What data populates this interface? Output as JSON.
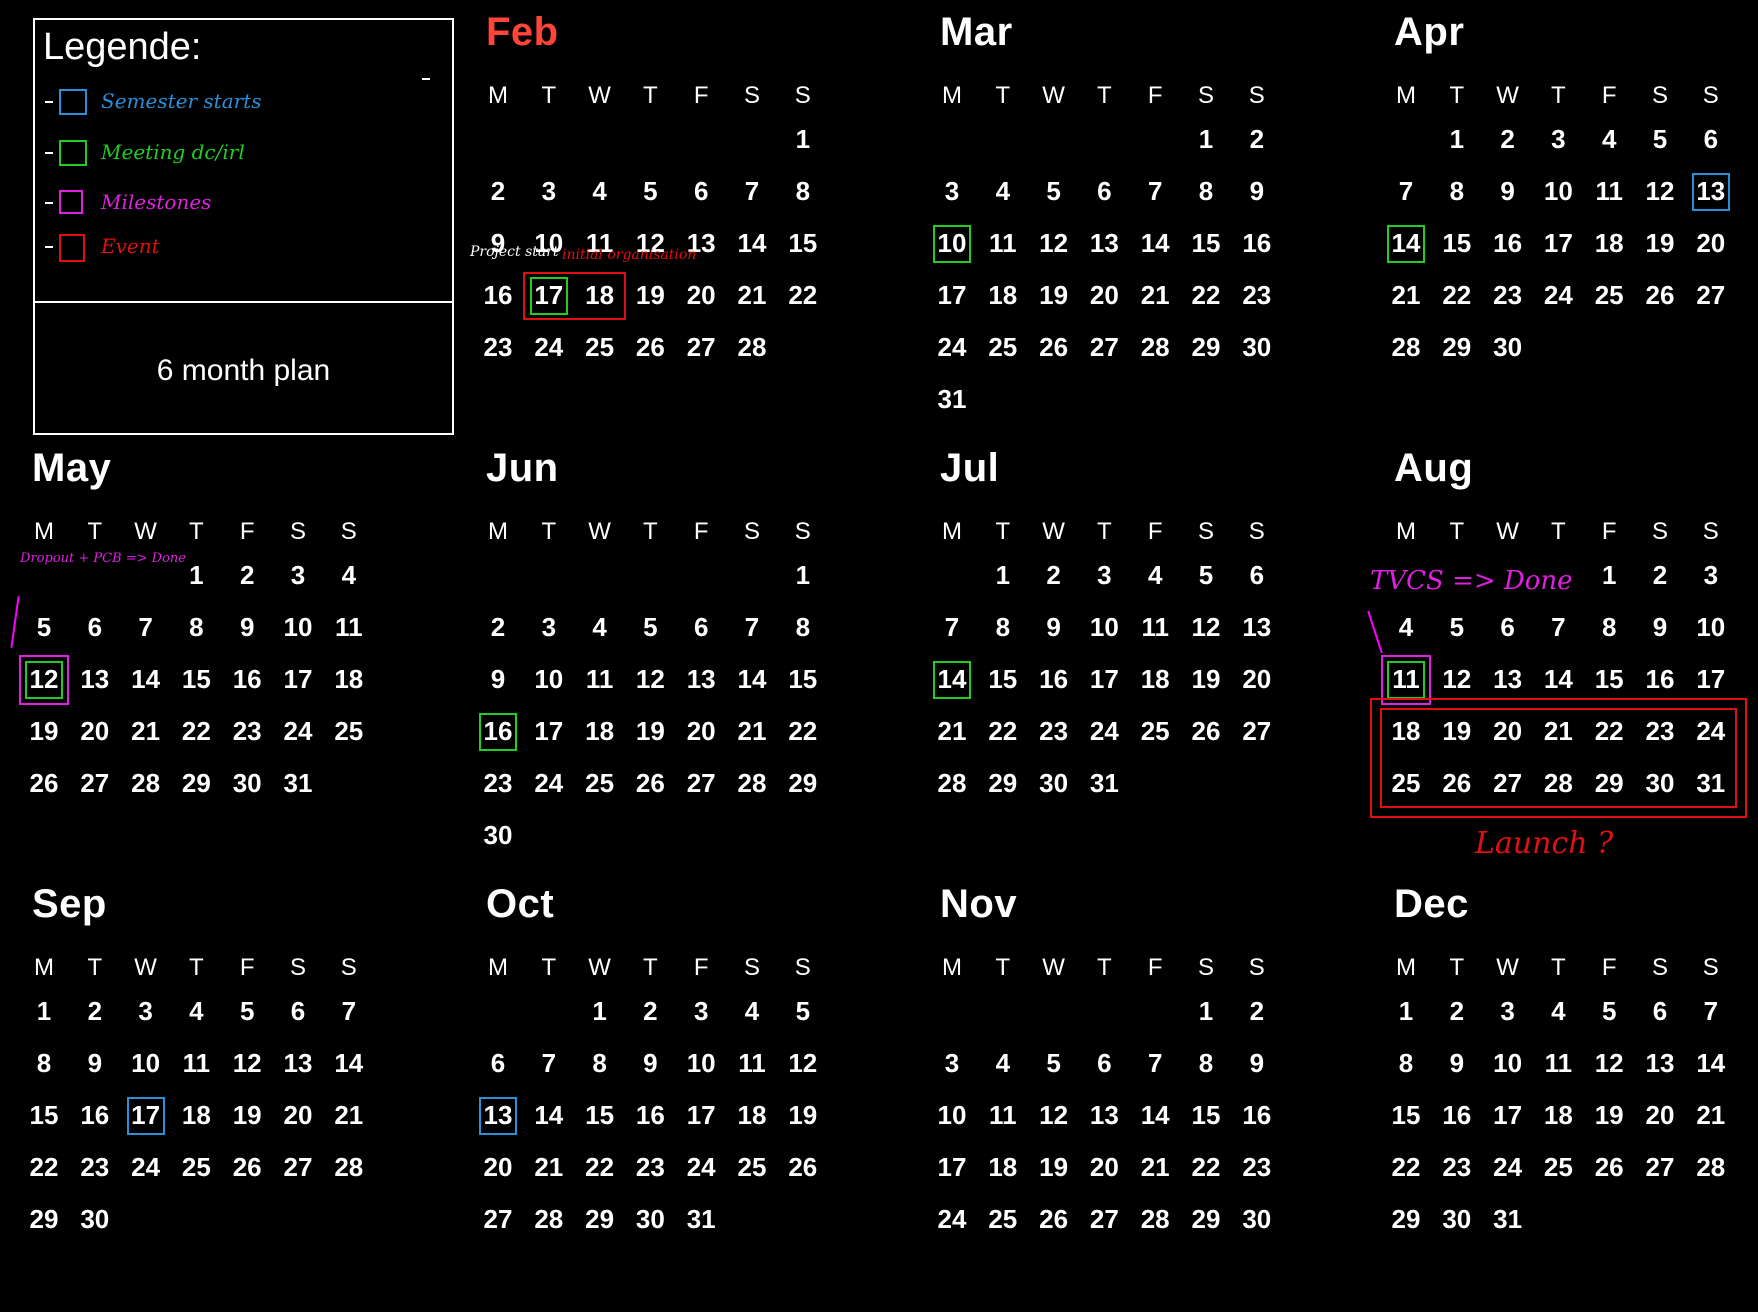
{
  "legend": {
    "title": "Legende:",
    "items": [
      {
        "label": "Semester starts",
        "color": "#2a8fd8"
      },
      {
        "label": "Meeting dc/irl",
        "color": "#22cc22"
      },
      {
        "label": "Milestones",
        "color": "#e020e0"
      },
      {
        "label": "Event",
        "color": "#e01010"
      }
    ],
    "plan": "6 month plan"
  },
  "weekday_headers": [
    "M",
    "T",
    "W",
    "T",
    "F",
    "S",
    "S"
  ],
  "months": [
    {
      "name": "Feb",
      "start": 6,
      "days": 28,
      "color": "#ff453a"
    },
    {
      "name": "Mar",
      "start": 5,
      "days": 31
    },
    {
      "name": "Apr",
      "start": 1,
      "days": 30
    },
    {
      "name": "May",
      "start": 3,
      "days": 31
    },
    {
      "name": "Jun",
      "start": 6,
      "days": 30
    },
    {
      "name": "Jul",
      "start": 1,
      "days": 31
    },
    {
      "name": "Aug",
      "start": 4,
      "days": 31
    },
    {
      "name": "Sep",
      "start": 0,
      "days": 30
    },
    {
      "name": "Oct",
      "start": 2,
      "days": 31
    },
    {
      "name": "Nov",
      "start": 5,
      "days": 30
    },
    {
      "name": "Dec",
      "start": 0,
      "days": 31
    }
  ],
  "markers": [
    {
      "month": "Feb",
      "day": 17,
      "type": "Semester starts"
    },
    {
      "month": "Feb",
      "day": 17,
      "type": "Meeting dc/irl"
    },
    {
      "month": "Feb",
      "day": "17-18",
      "type": "Event"
    },
    {
      "month": "Mar",
      "day": 10,
      "type": "Meeting dc/irl"
    },
    {
      "month": "Apr",
      "day": 13,
      "type": "Semester starts"
    },
    {
      "month": "Apr",
      "day": 14,
      "type": "Meeting dc/irl"
    },
    {
      "month": "May",
      "day": 12,
      "type": "Meeting dc/irl"
    },
    {
      "month": "May",
      "day": 12,
      "type": "Milestones"
    },
    {
      "month": "Jun",
      "day": 16,
      "type": "Meeting dc/irl"
    },
    {
      "month": "Jul",
      "day": 14,
      "type": "Meeting dc/irl"
    },
    {
      "month": "Aug",
      "day": 11,
      "type": "Meeting dc/irl"
    },
    {
      "month": "Aug",
      "day": 11,
      "type": "Milestones"
    },
    {
      "month": "Aug",
      "day": "18-31",
      "type": "Event"
    },
    {
      "month": "Sep",
      "day": 17,
      "type": "Semester starts"
    },
    {
      "month": "Oct",
      "day": 13,
      "type": "Semester starts"
    }
  ],
  "annotations": {
    "project_start": "Project start",
    "initial_org": "initial organisation",
    "dropout_pcb": "Dropout + PCB => Done",
    "tvcs": "TVCS => Done",
    "launch": "Launch ?"
  }
}
